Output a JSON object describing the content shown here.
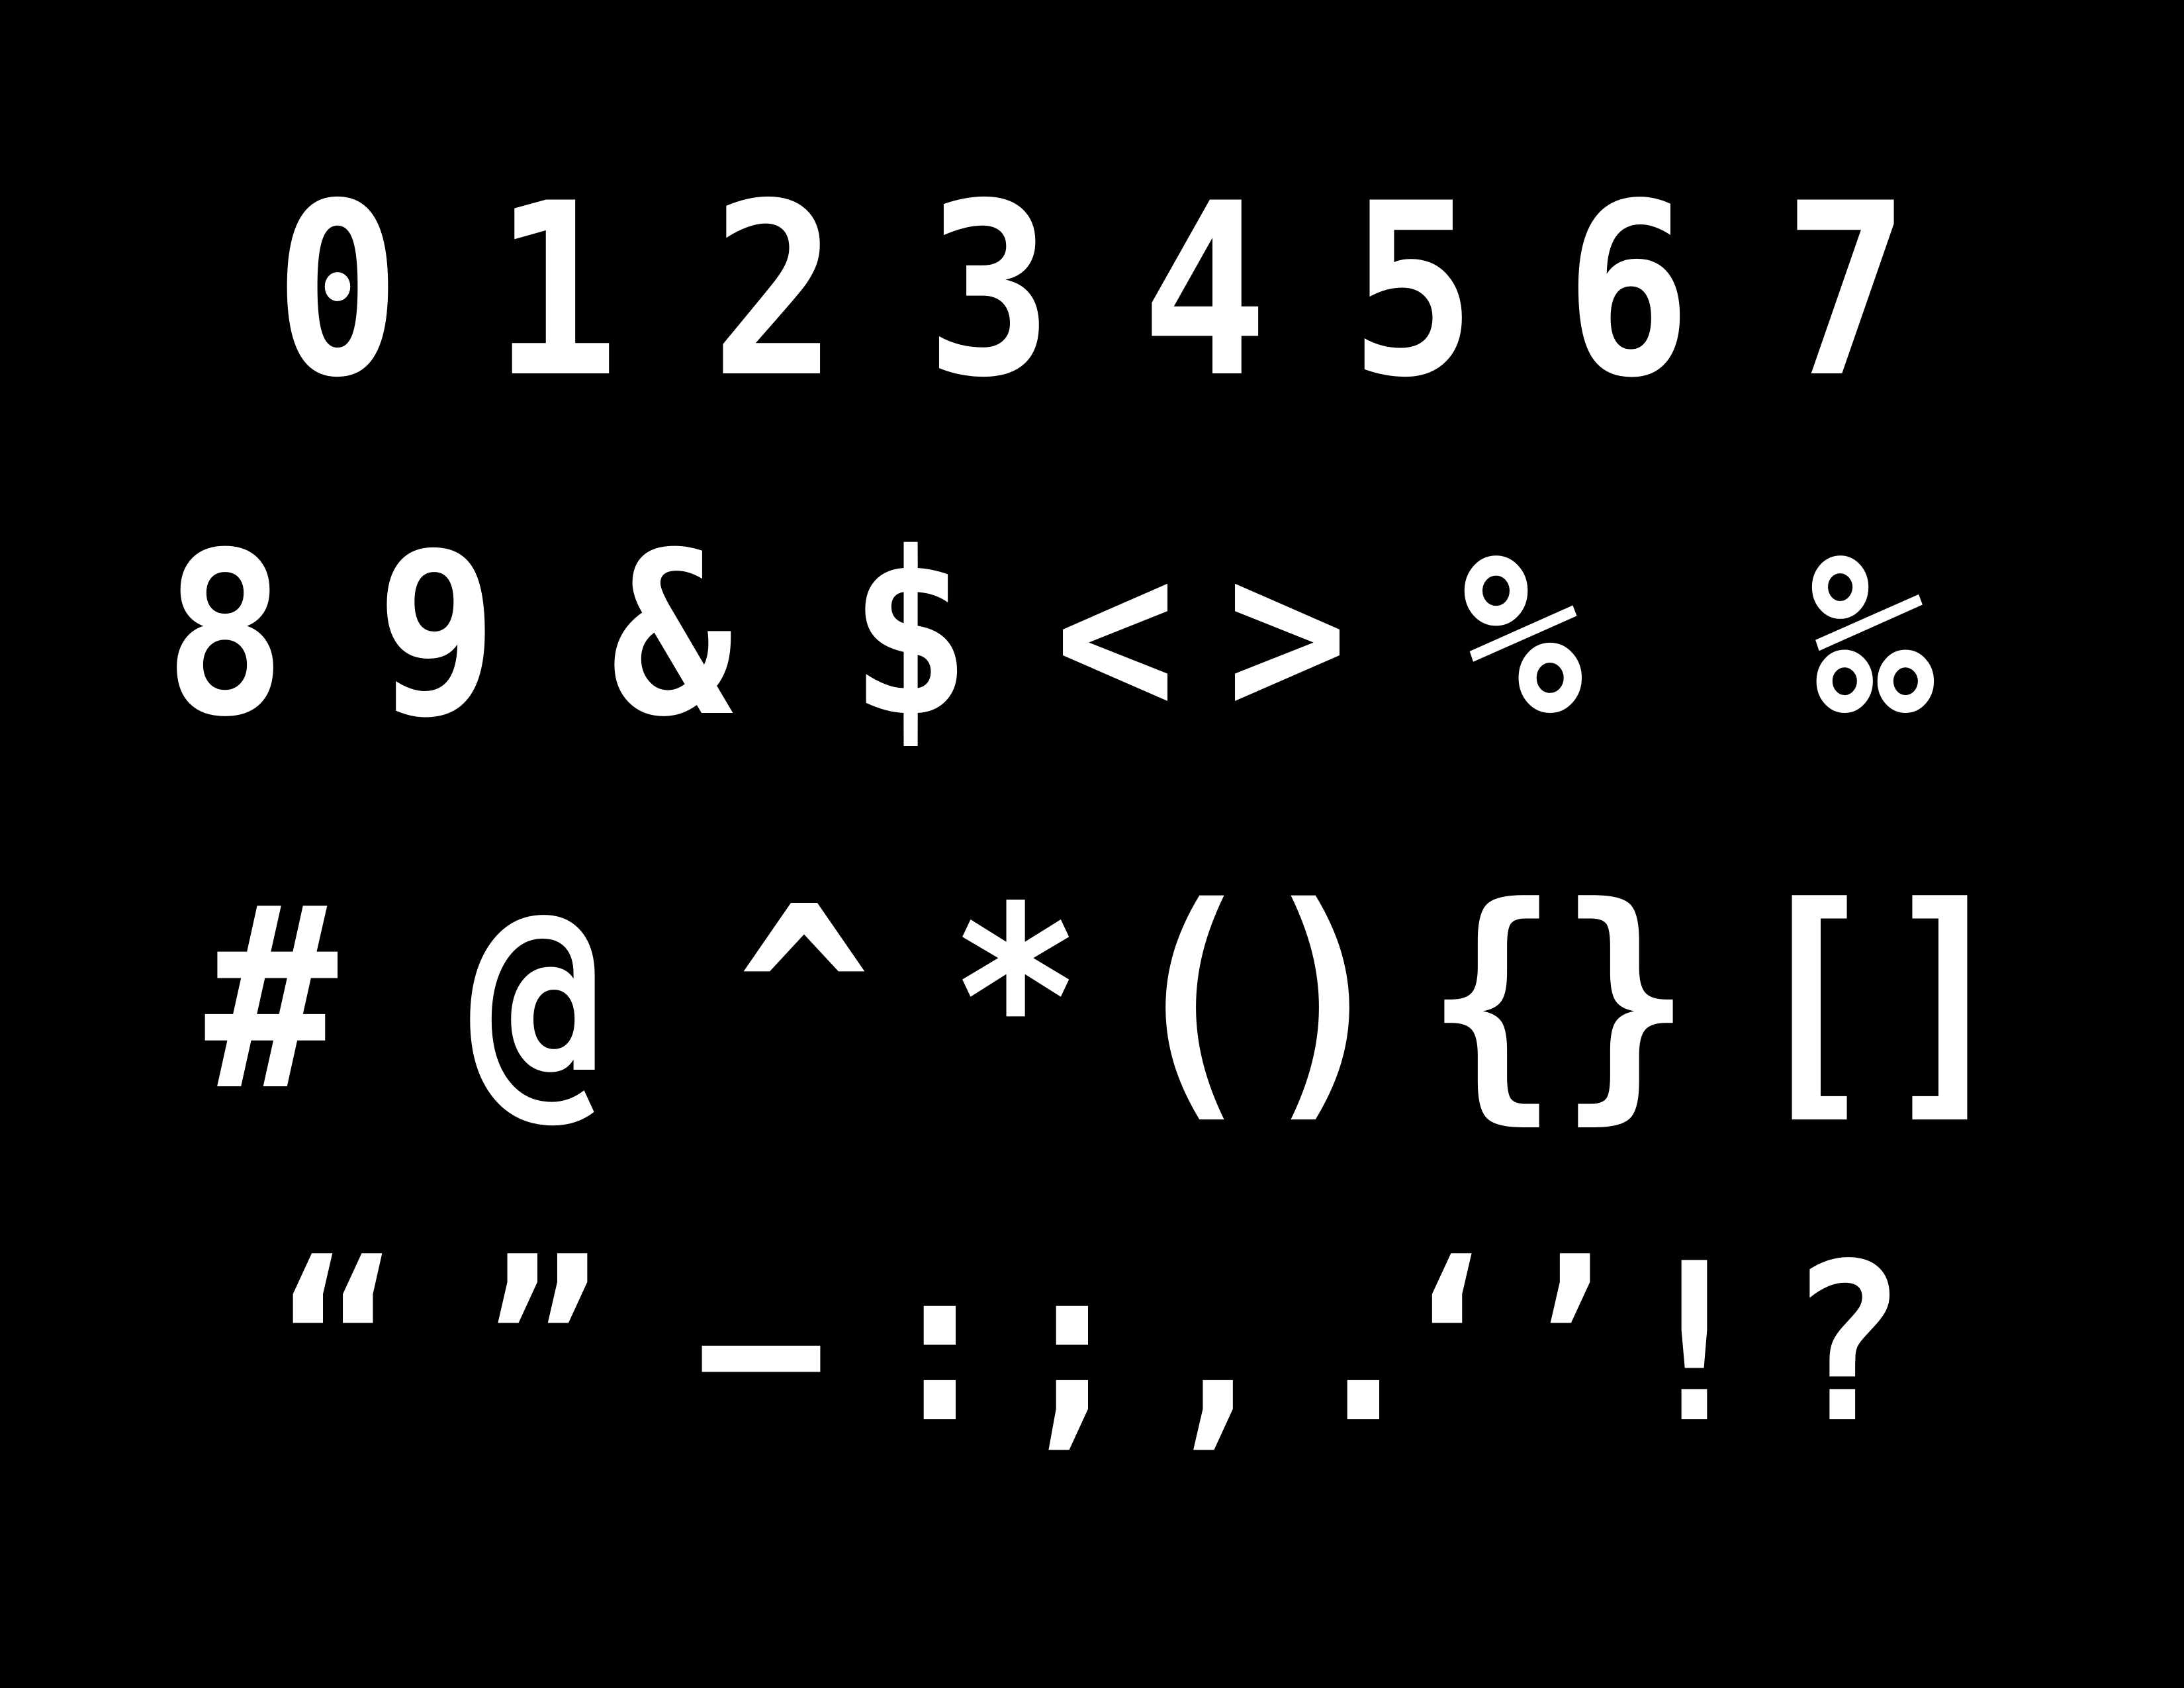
{
  "colors": {
    "background": "#000000",
    "glyph": "#ffffff"
  },
  "rows": [
    {
      "glyphs": [
        {
          "char": "0"
        },
        {
          "char": "1"
        },
        {
          "char": "2"
        },
        {
          "char": "3"
        },
        {
          "char": "4"
        },
        {
          "char": "5"
        },
        {
          "char": "6"
        },
        {
          "char": "7"
        }
      ]
    },
    {
      "glyphs": [
        {
          "char": "8"
        },
        {
          "char": "9"
        },
        {
          "char": "&"
        },
        {
          "char": "$"
        },
        {
          "char": "<"
        },
        {
          "char": ">"
        },
        {
          "char": "%"
        },
        {
          "char": "‰"
        }
      ]
    },
    {
      "glyphs": [
        {
          "char": "#"
        },
        {
          "char": "@"
        },
        {
          "char": "^"
        },
        {
          "char": "*"
        },
        {
          "char": "()"
        },
        {
          "char": "{}"
        },
        {
          "char": "[]"
        }
      ]
    },
    {
      "glyphs": [
        {
          "char": "“"
        },
        {
          "char": "”"
        },
        {
          "char": "–"
        },
        {
          "char": ":"
        },
        {
          "char": ";"
        },
        {
          "char": ","
        },
        {
          "char": "."
        },
        {
          "char": "‘’"
        },
        {
          "char": "!"
        },
        {
          "char": "?"
        }
      ]
    }
  ]
}
